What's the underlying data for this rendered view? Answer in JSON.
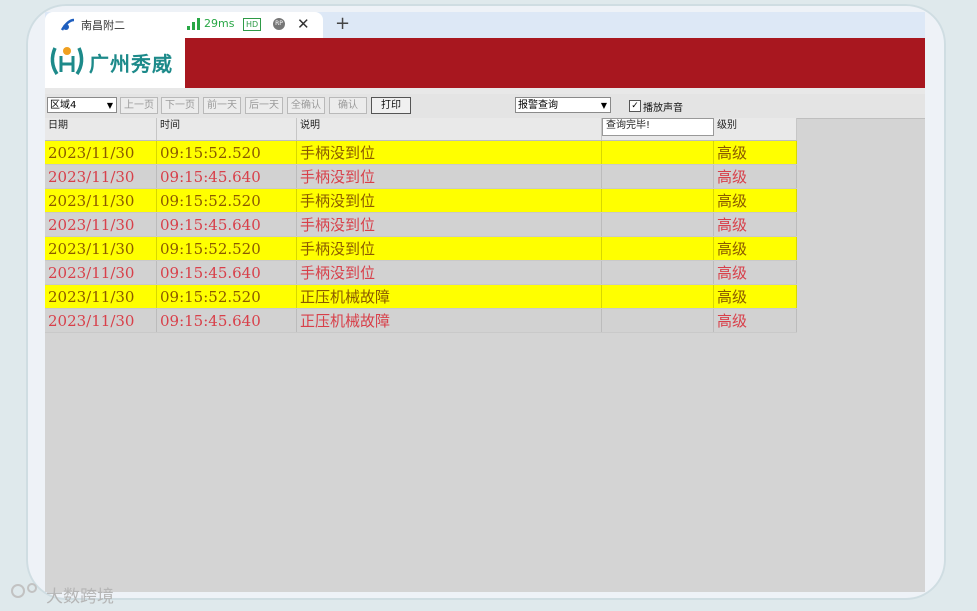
{
  "browser": {
    "tab_title": "南昌附二",
    "ping": "29ms",
    "hd_badge": "HD",
    "rec_badge": "RP",
    "close_symbol": "✕",
    "new_tab_symbol": "+"
  },
  "header": {
    "logo_text": "广州秀威",
    "logo_color": "#1d8a8a",
    "bar_color": "#a8171f"
  },
  "toolbar": {
    "area_select": "区域4",
    "prev_page": "上一页",
    "next_page": "下一页",
    "prev_day": "前一天",
    "next_day": "后一天",
    "confirm_all": "全确认",
    "confirm": "确认",
    "print": "打印",
    "query_select": "报警查询",
    "play_sound_label": "播放声音",
    "play_sound_checked": true
  },
  "table": {
    "headers": {
      "date": "日期",
      "time": "时间",
      "desc": "说明",
      "status": "查询完毕!",
      "level": "级别"
    },
    "rows": [
      {
        "date": "2023/11/30",
        "time": "09:15:52.520",
        "desc": "手柄没到位",
        "level": "高级",
        "style": "yellow"
      },
      {
        "date": "2023/11/30",
        "time": "09:15:45.640",
        "desc": "手柄没到位",
        "level": "高级",
        "style": "gray"
      },
      {
        "date": "2023/11/30",
        "time": "09:15:52.520",
        "desc": "手柄没到位",
        "level": "高级",
        "style": "yellow"
      },
      {
        "date": "2023/11/30",
        "time": "09:15:45.640",
        "desc": "手柄没到位",
        "level": "高级",
        "style": "gray"
      },
      {
        "date": "2023/11/30",
        "time": "09:15:52.520",
        "desc": "手柄没到位",
        "level": "高级",
        "style": "yellow"
      },
      {
        "date": "2023/11/30",
        "time": "09:15:45.640",
        "desc": "手柄没到位",
        "level": "高级",
        "style": "gray"
      },
      {
        "date": "2023/11/30",
        "time": "09:15:52.520",
        "desc": "正压机械故障",
        "level": "高级",
        "style": "yellow"
      },
      {
        "date": "2023/11/30",
        "time": "09:15:45.640",
        "desc": "正压机械故障",
        "level": "高级",
        "style": "gray"
      }
    ]
  },
  "watermark": "大数跨境"
}
